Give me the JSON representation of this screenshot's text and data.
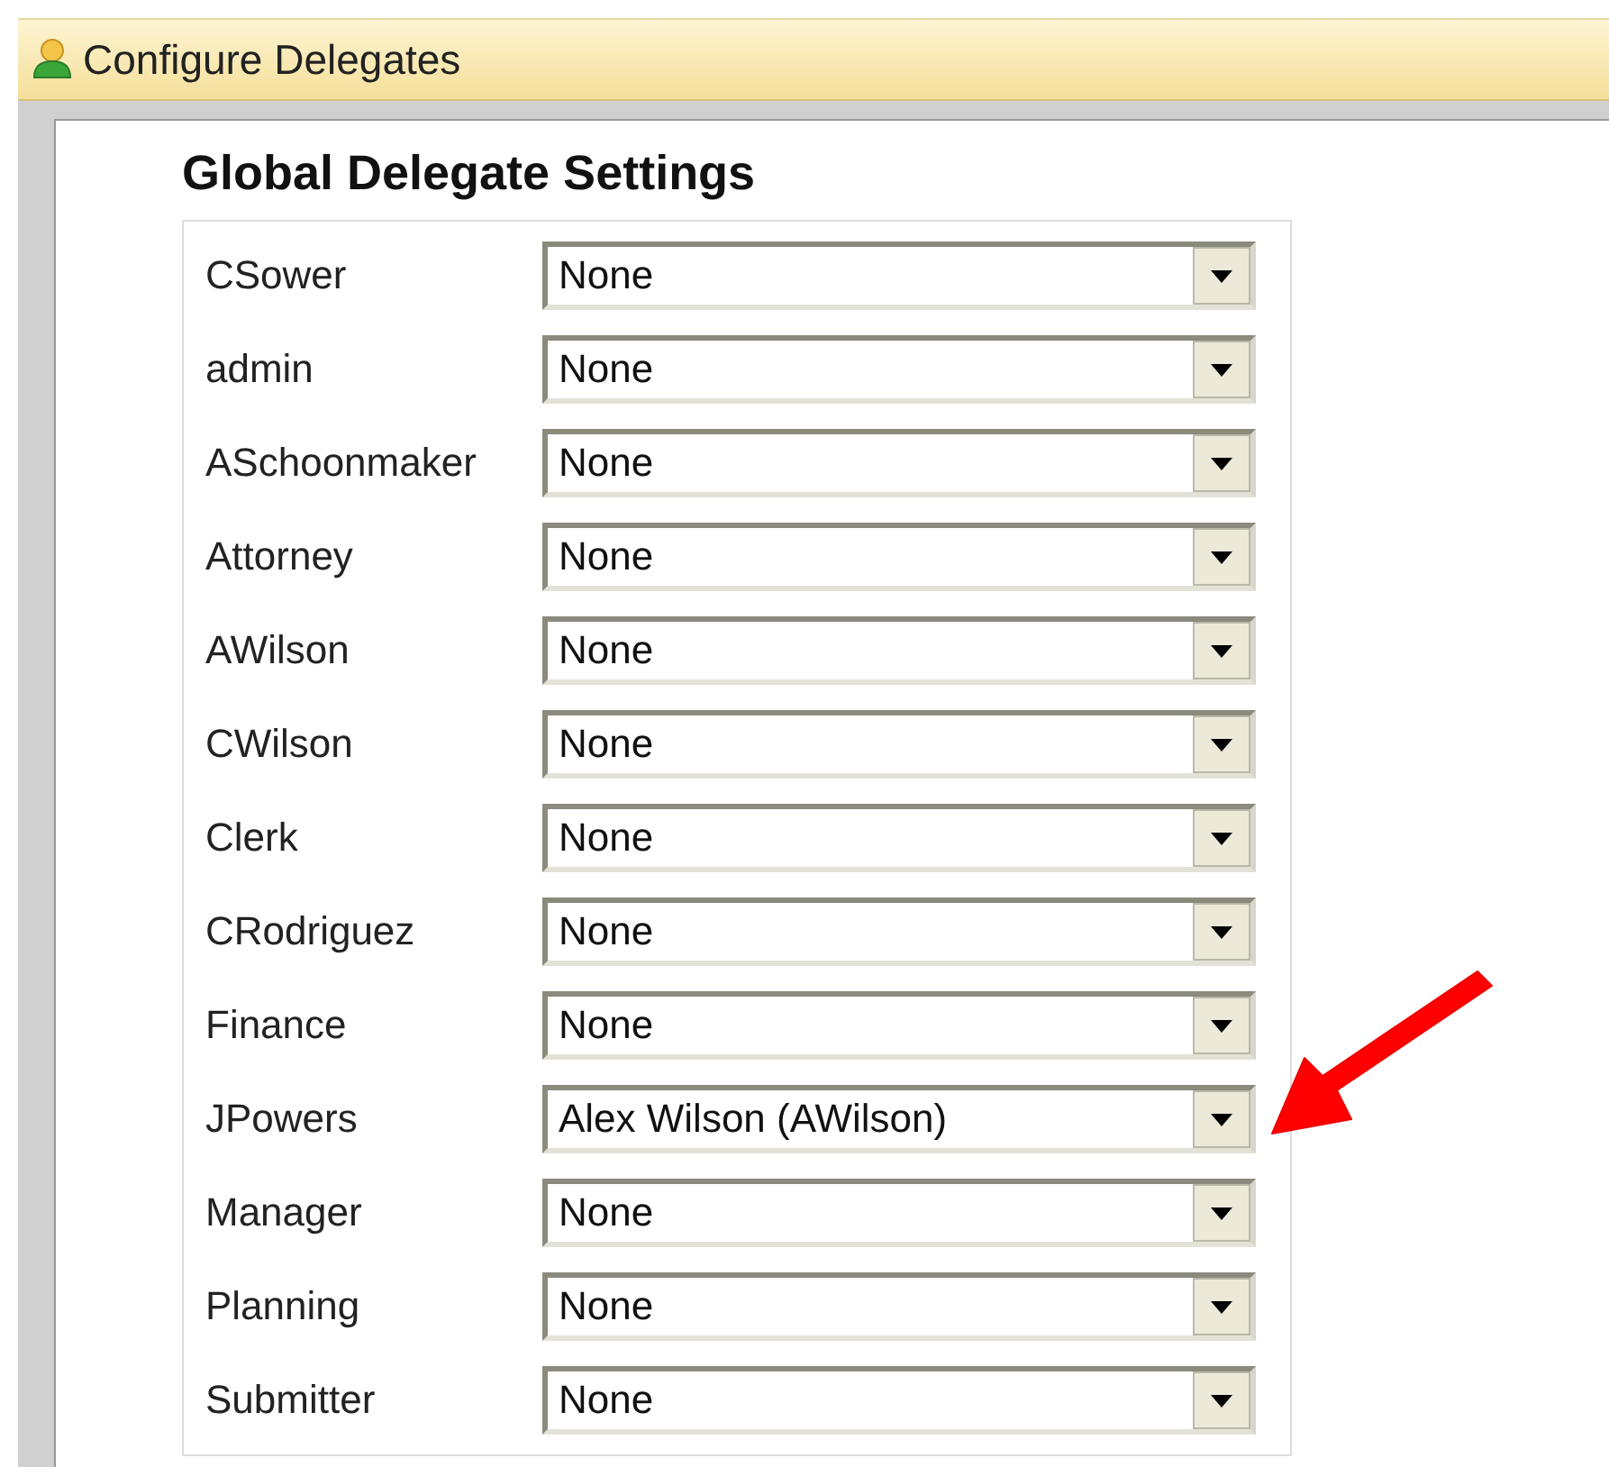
{
  "header": {
    "title": "Configure Delegates"
  },
  "section_title": "Global Delegate Settings",
  "delegates": [
    {
      "user": "CSower",
      "delegate": "None"
    },
    {
      "user": "admin",
      "delegate": "None"
    },
    {
      "user": "ASchoonmaker",
      "delegate": "None"
    },
    {
      "user": "Attorney",
      "delegate": "None"
    },
    {
      "user": "AWilson",
      "delegate": "None"
    },
    {
      "user": "CWilson",
      "delegate": "None"
    },
    {
      "user": "Clerk",
      "delegate": "None"
    },
    {
      "user": "CRodriguez",
      "delegate": "None"
    },
    {
      "user": "Finance",
      "delegate": "None"
    },
    {
      "user": "JPowers",
      "delegate": "Alex Wilson (AWilson)"
    },
    {
      "user": "Manager",
      "delegate": "None"
    },
    {
      "user": "Planning",
      "delegate": "None"
    },
    {
      "user": "Submitter",
      "delegate": "None"
    }
  ]
}
